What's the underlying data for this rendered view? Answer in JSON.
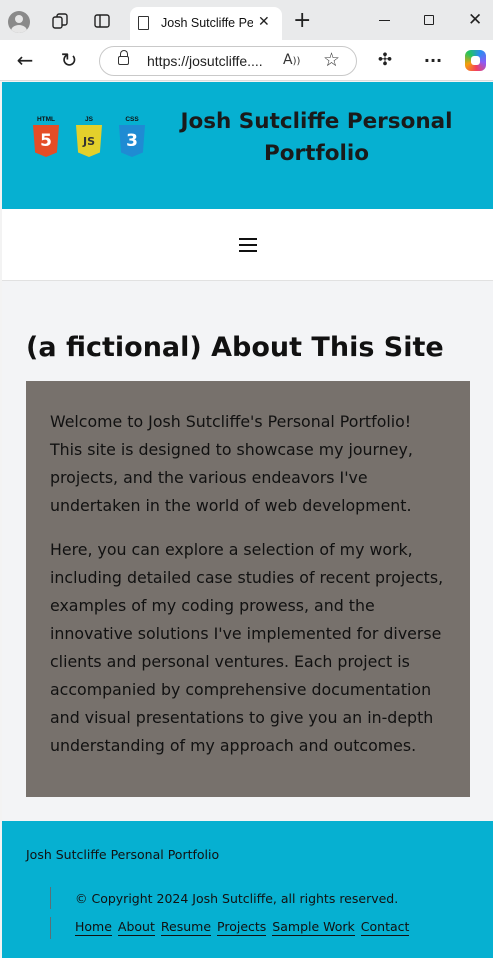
{
  "browser": {
    "tab_title": "Josh Sutcliffe Personal Portfolio",
    "tab_close": "✕",
    "new_tab": "+",
    "url": "https://josutcliffe....",
    "read_aloud": "A̅",
    "favorite": "☆",
    "more": "···",
    "back": "←",
    "refresh": "↻",
    "extensions": "✣",
    "close_window": "✕"
  },
  "header": {
    "title": "Josh Sutcliffe Personal Portfolio",
    "badges": [
      {
        "label": "HTML",
        "number": "5",
        "color": "#e44d26",
        "icon": "html5-icon"
      },
      {
        "label": "JS",
        "number": "JS",
        "color": "#e3d02b",
        "icon": "javascript-icon"
      },
      {
        "label": "CSS",
        "number": "3",
        "color": "#1f8bd3",
        "icon": "css3-icon"
      }
    ]
  },
  "nav": {
    "menu_icon": "hamburger-menu-icon"
  },
  "main": {
    "heading": "(a fictional) About This Site",
    "paragraphs": [
      "Welcome to Josh Sutcliffe's Personal Portfolio! This site is designed to showcase my journey, projects, and the various endeavors I've undertaken in the world of web development.",
      "Here, you can explore a selection of my work, including detailed case studies of recent projects, examples of my coding prowess, and the innovative solutions I've implemented for diverse clients and personal ventures. Each project is accompanied by comprehensive documentation and visual presentations to give you an in-depth understanding of my approach and outcomes."
    ]
  },
  "footer": {
    "site_name": "Josh Sutcliffe Personal Portfolio",
    "copyright": "© Copyright 2024 Josh Sutcliffe, all rights reserved.",
    "links": [
      "Home",
      "About",
      "Resume",
      "Projects",
      "Sample Work",
      "Contact"
    ]
  },
  "colors": {
    "header_bg": "#06b0d1",
    "content_box": "#77716c",
    "footer_bg": "#06b0d1"
  }
}
